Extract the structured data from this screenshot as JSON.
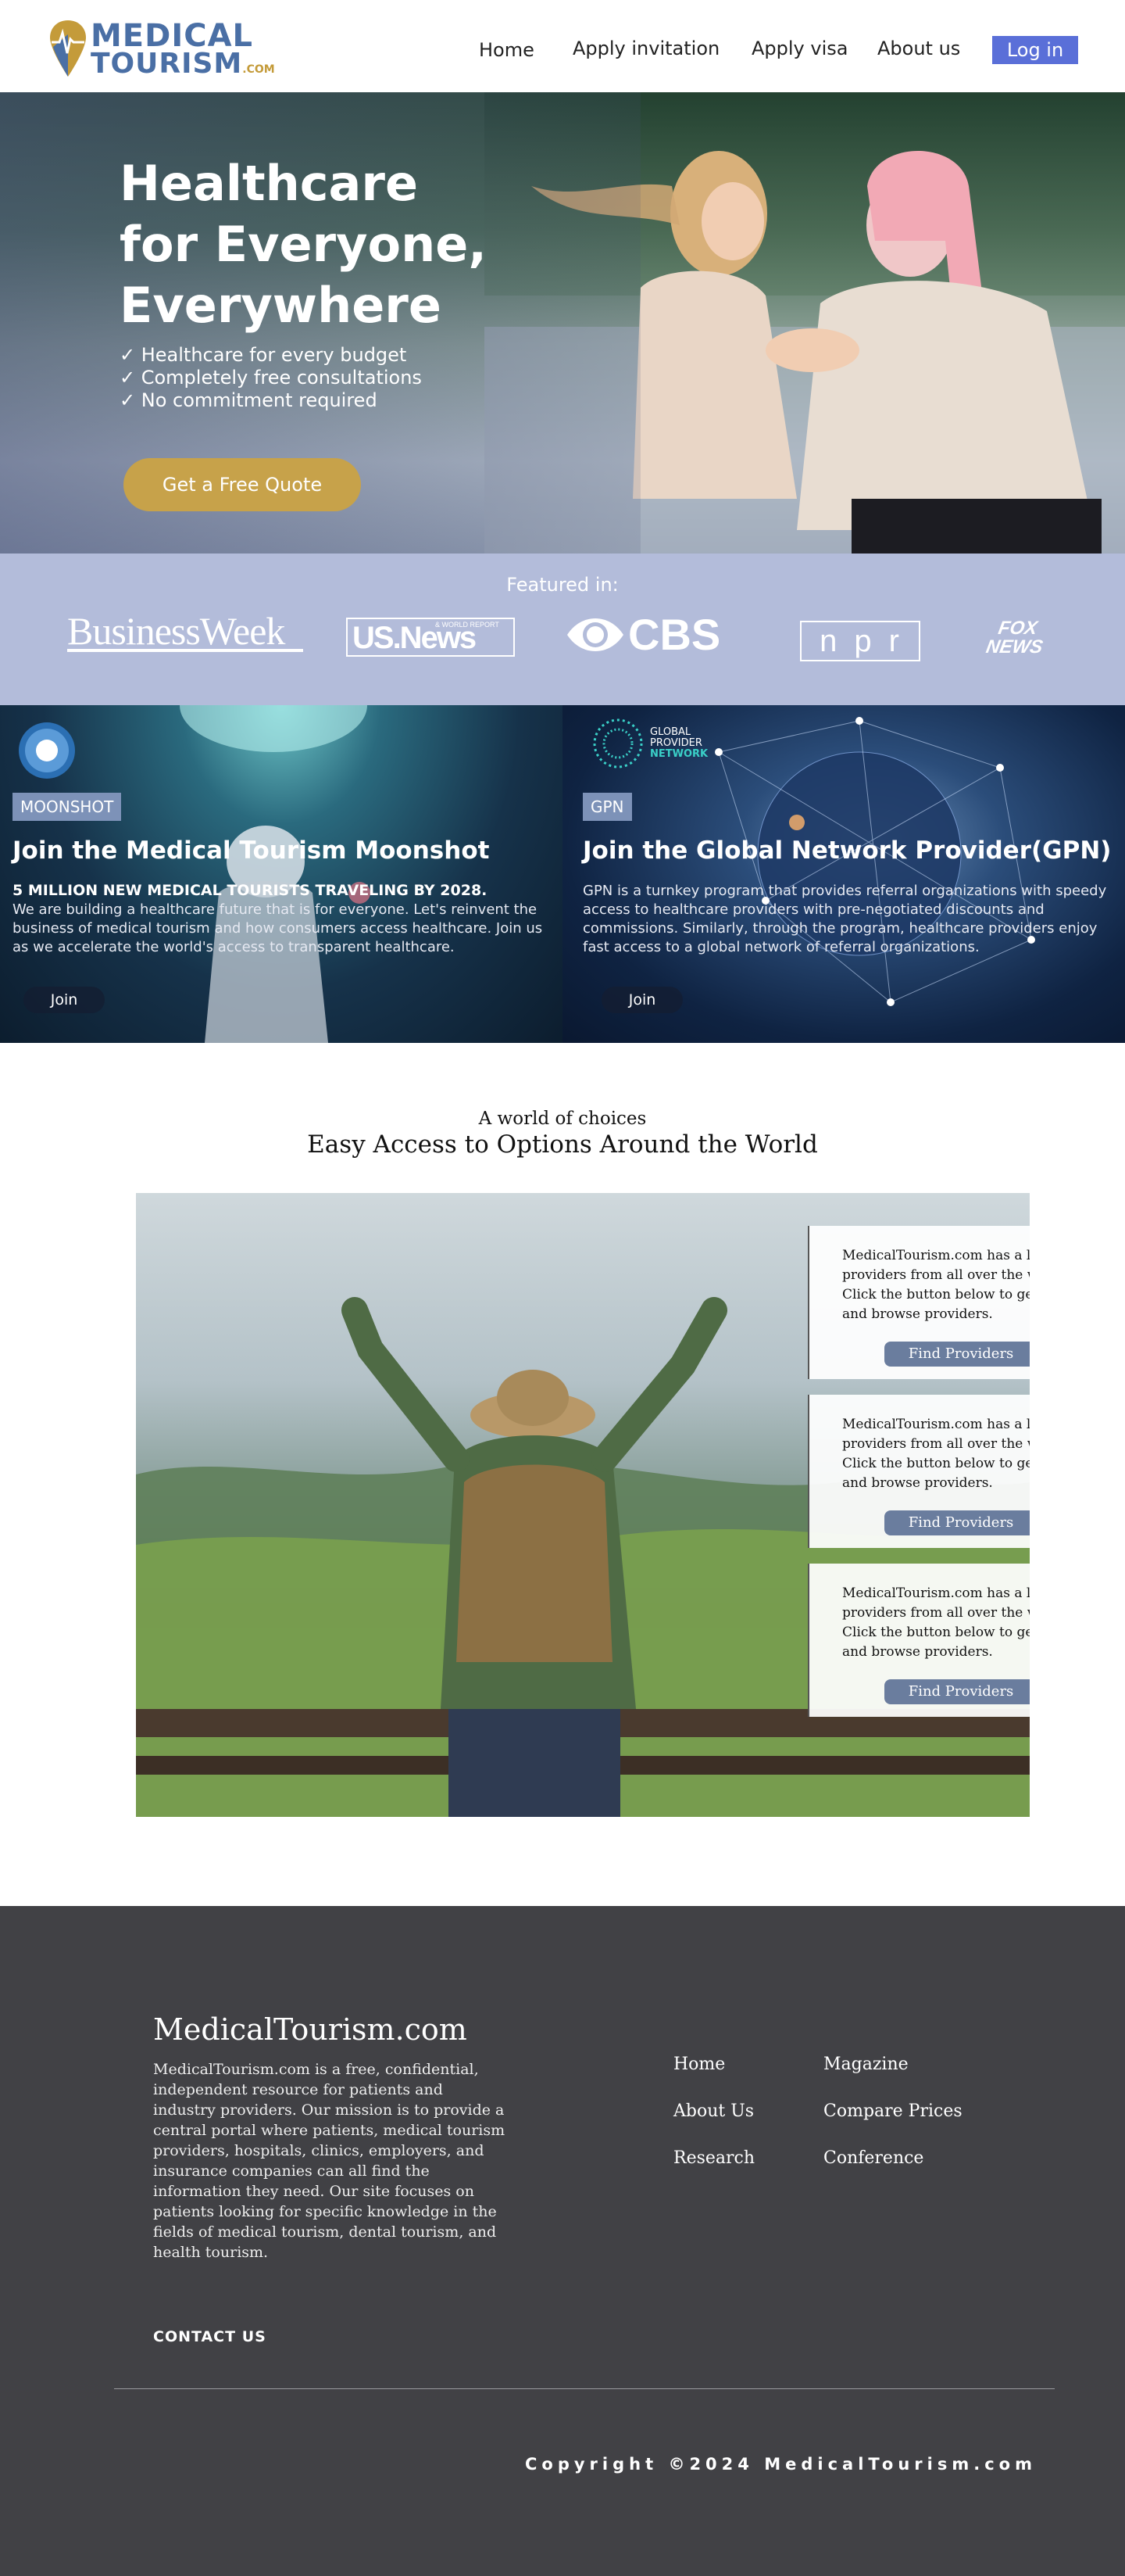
{
  "brand": {
    "line1": "MEDICAL",
    "line2": "TOURISM",
    "suffix": ".COM"
  },
  "nav": {
    "items": [
      "Home",
      "Apply invitation",
      "Apply visa",
      "About us"
    ],
    "login_label": "Log in"
  },
  "hero": {
    "title_lines": [
      "Healthcare",
      "for Everyone,",
      "Everywhere"
    ],
    "bullets": [
      "✓ Healthcare for every budget",
      "✓ Completely free consultations",
      "✓ No commitment required"
    ],
    "cta_label": "Get a Free Quote"
  },
  "featured": {
    "label": "Featured in:",
    "logos": [
      "BusinessWeek",
      "US.News",
      "CBS",
      "npr",
      "FOX NEWS"
    ],
    "usnews_sub": "& WORLD REPORT"
  },
  "promos": [
    {
      "badge": "MOONSHOT",
      "title": "Join the Medical Tourism Moonshot",
      "subtitle": "5 MILLION NEW MEDICAL TOURISTS TRAVELING BY 2028.",
      "body": "We are building a healthcare future that is for everyone. Let's reinvent the business of medical tourism and how consumers access healthcare. Join us as we accelerate the world's access to transparent healthcare.",
      "button": "Join"
    },
    {
      "badge": "GPN",
      "logo_lines": [
        "GLOBAL",
        "PROVIDER",
        "NETWORK"
      ],
      "title": "Join the Global Network Provider(GPN)",
      "body": "GPN is a turnkey program that provides referral organizations with speedy access to healthcare providers with pre-negotiated discounts and commissions. Similarly, through the program, healthcare providers enjoy fast access to a global network of referral organizations.",
      "button": "Join"
    }
  ],
  "choices": {
    "kicker": "A world of choices",
    "title": "Easy Access to Options Around the World",
    "cards": [
      {
        "text": "MedicalTourism.com has a list of providers from all over the world. Click the button below to get started and browse providers.",
        "button": "Find Providers"
      },
      {
        "text": "MedicalTourism.com has a list of providers from all over the world. Click the button below to get started and browse providers.",
        "button": "Find Providers"
      },
      {
        "text": "MedicalTourism.com has a list of providers from all over the world. Click the button below to get started and browse providers.",
        "button": "Find Providers"
      }
    ]
  },
  "footer": {
    "brand": "MedicalTourism.com",
    "description": "MedicalTourism.com is a free, confidential, independent resource for patients and industry providers. Our mission is to provide a central portal where patients, medical tourism providers, hospitals, clinics, employers, and insurance companies can all find the information they need. Our site focuses on patients looking for specific knowledge in the fields of medical tourism, dental tourism, and health tourism.",
    "contact": "CONTACT US",
    "links_col1": [
      "Home",
      "About Us",
      "Research"
    ],
    "links_col2": [
      "Magazine",
      "Compare Prices",
      "Conference"
    ],
    "copyright": "Copyright ©2024 MedicalTourism.com"
  },
  "colors": {
    "accent": "#5a6fd8",
    "gold": "#c7a24a",
    "brand_blue": "#4a6fa5",
    "footer_bg": "#414145",
    "featured_bg": "#b3bcda"
  }
}
